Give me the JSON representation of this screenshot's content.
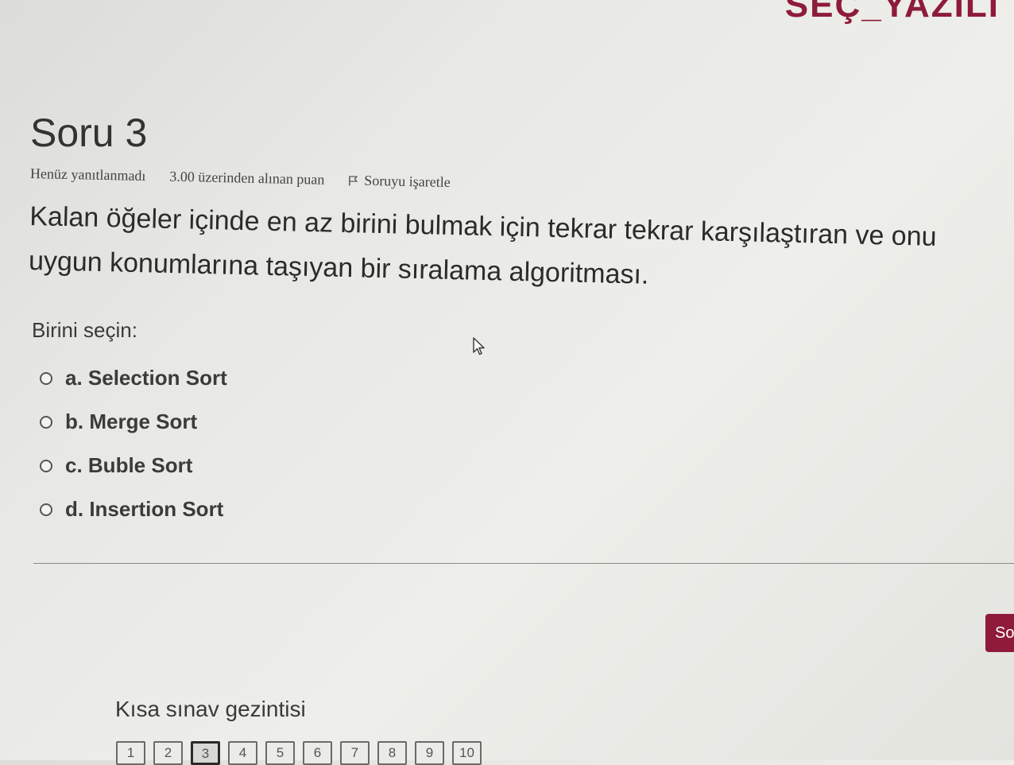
{
  "header": {
    "logo_fragment": "SEÇ_YAZILI"
  },
  "question": {
    "title": "Soru 3",
    "status": "Henüz yanıtlanmadı",
    "points": "3.00 üzerinden alınan puan",
    "flag_label": "Soruyu işaretle",
    "text": "Kalan öğeler içinde en az birini bulmak için tekrar tekrar karşılaştıran ve onu uygun konumlarına taşıyan bir sıralama algoritması.",
    "prompt": "Birini seçin:",
    "answers": [
      {
        "label": "a. Selection Sort"
      },
      {
        "label": "b. Merge Sort"
      },
      {
        "label": "c. Buble Sort"
      },
      {
        "label": "d. Insertion Sort"
      }
    ]
  },
  "next_button": {
    "label": "Sonraki sayfa"
  },
  "navigation": {
    "title": "Kısa sınav gezintisi",
    "buttons": [
      "1",
      "2",
      "3",
      "4",
      "5",
      "6",
      "7",
      "8",
      "9",
      "10"
    ],
    "current": "3"
  },
  "colors": {
    "accent": "#8e1b3a"
  }
}
